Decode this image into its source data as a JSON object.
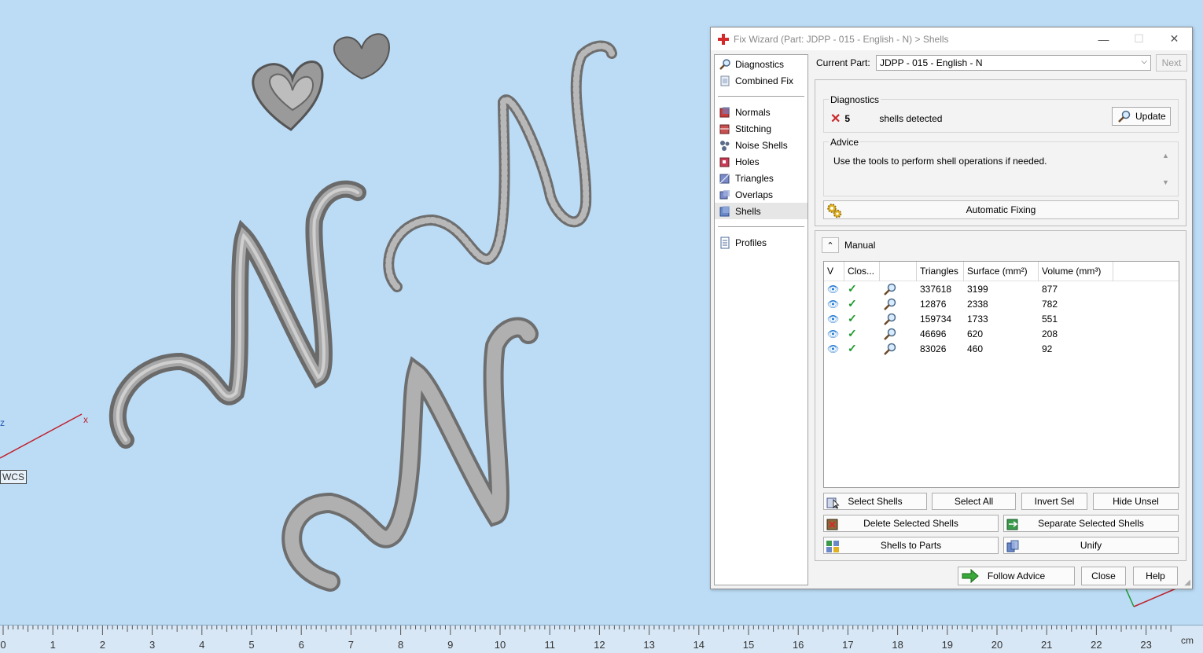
{
  "viewport": {
    "wcs_label": "WCS",
    "axis_x": "x",
    "axis_z": "z"
  },
  "ruler": {
    "ticks": [
      "0",
      "1",
      "2",
      "3",
      "4",
      "5",
      "6",
      "7",
      "8",
      "9",
      "10",
      "11",
      "12",
      "13",
      "14",
      "15",
      "16",
      "17",
      "18",
      "19",
      "20",
      "21",
      "22",
      "23"
    ],
    "unit": "cm"
  },
  "dialog": {
    "title": "Fix Wizard (Part: JDPP - 015 - English - N) > Shells",
    "window_buttons": {
      "minimize": "—",
      "maximize": "☐",
      "close": "✕"
    },
    "nav": {
      "group1": [
        {
          "label": "Diagnostics",
          "icon": "magnifier-icon"
        },
        {
          "label": "Combined Fix",
          "icon": "combined-fix-icon"
        }
      ],
      "group2": [
        {
          "label": "Normals",
          "icon": "normals-icon"
        },
        {
          "label": "Stitching",
          "icon": "stitching-icon"
        },
        {
          "label": "Noise Shells",
          "icon": "noise-shells-icon"
        },
        {
          "label": "Holes",
          "icon": "holes-icon"
        },
        {
          "label": "Triangles",
          "icon": "triangles-icon"
        },
        {
          "label": "Overlaps",
          "icon": "overlaps-icon"
        },
        {
          "label": "Shells",
          "icon": "shells-icon",
          "selected": true
        }
      ],
      "group3": [
        {
          "label": "Profiles",
          "icon": "profiles-icon"
        }
      ]
    },
    "current_part_label": "Current Part:",
    "current_part_value": "JDPP - 015 - English - N",
    "next_label": "Next",
    "diagnostics": {
      "title": "Diagnostics",
      "count": "5",
      "message": "shells detected",
      "update_label": "Update"
    },
    "advice": {
      "title": "Advice",
      "text": "Use the tools to perform shell operations if needed."
    },
    "automatic_fixing_label": "Automatic Fixing",
    "manual": {
      "title": "Manual",
      "columns": [
        "V",
        "Clos...",
        "",
        "Triangles",
        "Surface (mm²)",
        "Volume (mm³)"
      ],
      "rows": [
        {
          "triangles": "337618",
          "surface": "3199",
          "volume": "877"
        },
        {
          "triangles": "12876",
          "surface": "2338",
          "volume": "782"
        },
        {
          "triangles": "159734",
          "surface": "1733",
          "volume": "551"
        },
        {
          "triangles": "46696",
          "surface": "620",
          "volume": "208"
        },
        {
          "triangles": "83026",
          "surface": "460",
          "volume": "92"
        }
      ],
      "buttons": {
        "select_shells": "Select Shells",
        "select_all": "Select All",
        "invert_sel": "Invert Sel",
        "hide_unsel": "Hide Unsel",
        "delete_selected": "Delete Selected Shells",
        "separate_selected": "Separate Selected Shells",
        "shells_to_parts": "Shells to Parts",
        "unify": "Unify"
      }
    },
    "footer": {
      "follow_advice": "Follow Advice",
      "close": "Close",
      "help": "Help"
    },
    "colors": {
      "accent_blue": "#2b7fd6",
      "check_green": "#1e9a2e",
      "error_red": "#c8272b"
    }
  }
}
